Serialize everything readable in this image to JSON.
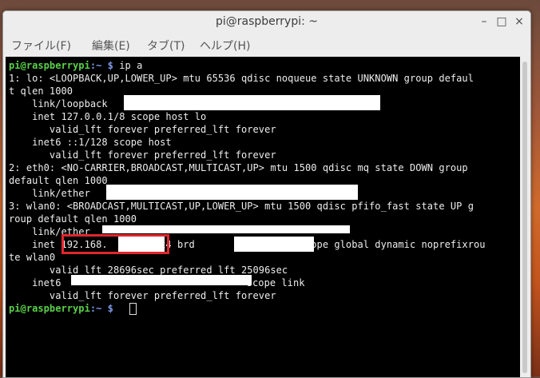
{
  "window": {
    "title": "pi@raspberrypi: ~"
  },
  "controls": {
    "minimize": "–",
    "maximize": "□",
    "close": "×"
  },
  "menu": {
    "file": "ファイル(F)",
    "edit": "編集(E)",
    "tabs": "タブ(T)",
    "help": "ヘルプ(H)"
  },
  "terminal": {
    "prompt_user": "pi@raspberrypi",
    "prompt_path": ":~ $",
    "command": " ip a",
    "lines": [
      "1: lo: <LOOPBACK,UP,LOWER_UP> mtu 65536 qdisc noqueue state UNKNOWN group defaul",
      "t qlen 1000",
      "    link/loopback",
      "    inet 127.0.0.1/8 scope host lo",
      "       valid_lft forever preferred_lft forever",
      "    inet6 ::1/128 scope host",
      "       valid_lft forever preferred_lft forever",
      "2: eth0: <NO-CARRIER,BROADCAST,MULTICAST,UP> mtu 1500 qdisc mq state DOWN group",
      "default qlen 1000",
      "    link/ether",
      "3: wlan0: <BROADCAST,MULTICAST,UP,LOWER_UP> mtu 1500 qdisc pfifo_fast state UP g",
      "roup default qlen 1000",
      "    link/ether",
      "    inet 192.168.        /24 brd                  scope global dynamic noprefixrou",
      "te wlan0",
      "       valid_lft 28696sec preferred_lft 25096sec",
      "    inet6",
      "       valid_lft forever preferred_lft forever"
    ],
    "inet6_suffix": " scope link",
    "final_prompt_user": "pi@raspberrypi",
    "final_prompt_path": ":~ $"
  },
  "colors": {
    "prompt_user": "#5ad04a",
    "prompt_path": "#7f9ae8",
    "highlight_box": "#e0262e",
    "redaction": "#ffffff"
  }
}
